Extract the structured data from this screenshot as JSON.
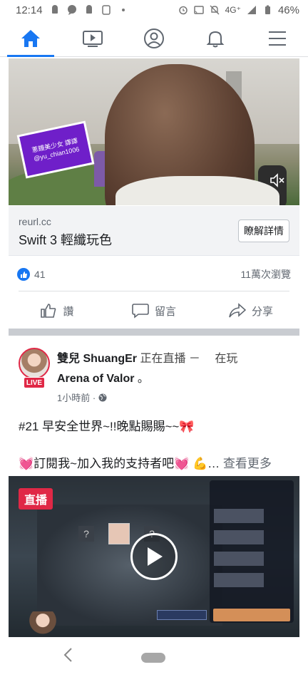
{
  "status_bar": {
    "time": "12:14",
    "network": "4G⁺",
    "battery": "46%"
  },
  "nav": {
    "items": [
      "home",
      "watch",
      "profile",
      "notifications",
      "menu"
    ]
  },
  "video1": {
    "badge_line1": "蔥鏝美少女 譯譯",
    "badge_line2": "@yu_chian1006"
  },
  "link": {
    "domain": "reurl.cc",
    "title": "Swift 3 輕纖玩色",
    "button": "瞭解詳情"
  },
  "reactions": {
    "count": "41",
    "views": "11萬次瀏覽"
  },
  "actions": {
    "like": "讚",
    "comment": "留言",
    "share": "分享"
  },
  "post": {
    "author": "雙兒 ShuangEr",
    "status": " 正在直播 －　 在玩",
    "game": "Arena of Valor",
    "period": " 。",
    "live_badge": "LIVE",
    "time": "1小時前 ·",
    "line1": "#21 早安全世界~!!晚點賜賜~~🎀",
    "line2": "💓訂閱我~加入我的支持者吧💓 💪…",
    "see_more": " 查看更多"
  },
  "video2": {
    "live_tag": "直播"
  },
  "colors": {
    "brand": "#1877f2",
    "live": "#e02846"
  }
}
